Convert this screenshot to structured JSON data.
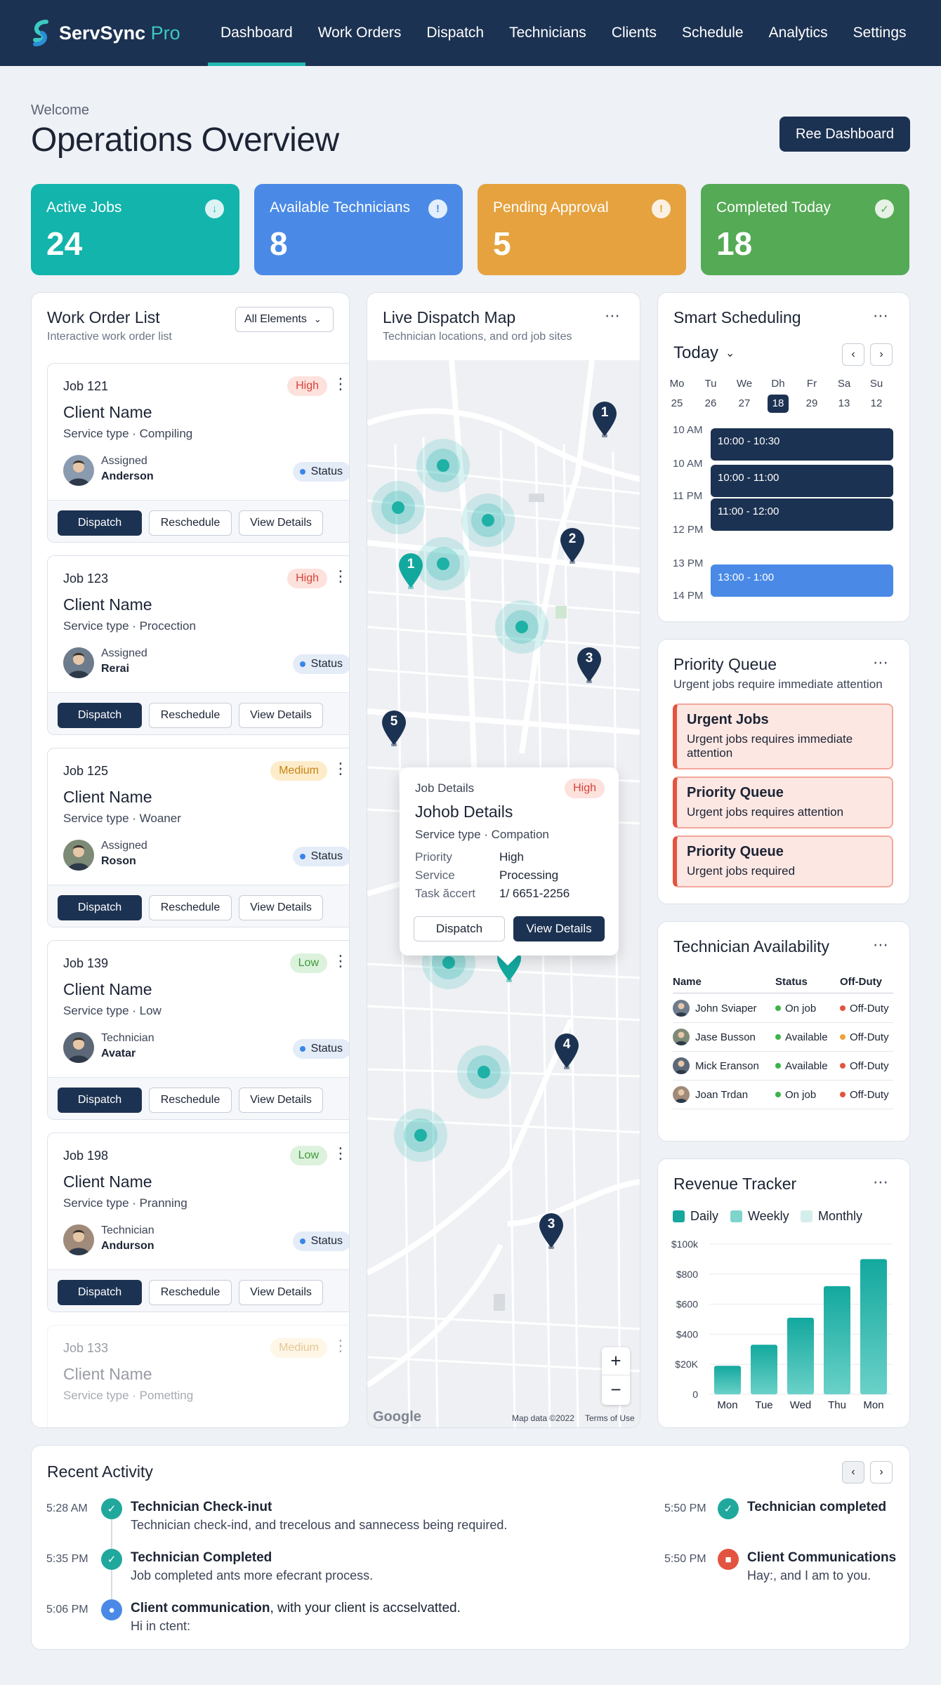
{
  "nav": {
    "brand": "ServSync",
    "brand_suffix": "Pro",
    "links": [
      "Dashboard",
      "Work Orders",
      "Dispatch",
      "Technicians",
      "Clients",
      "Schedule",
      "Analytics",
      "Settings"
    ],
    "active": "Dashboard"
  },
  "header": {
    "welcome": "Welcome",
    "title": "Operations Overview",
    "button": "Ree Dashboard"
  },
  "stats": [
    {
      "label": "Active Jobs",
      "value": "24",
      "color": "#13b4ac",
      "icon": "arrow-down-icon"
    },
    {
      "label": "Available Technicians",
      "value": "8",
      "color": "#4a8ae6",
      "icon": "info-icon"
    },
    {
      "label": "Pending Approval",
      "value": "5",
      "color": "#e5a23e",
      "icon": "alert-icon"
    },
    {
      "label": "Completed Today",
      "value": "18",
      "color": "#55aa55",
      "icon": "check-icon"
    }
  ],
  "work_orders": {
    "title": "Work Order List",
    "subtitle": "Interactive work order list",
    "filter": "All Elements",
    "jobs": [
      {
        "id": "Job 121",
        "priority": "High",
        "client": "Client Name",
        "service": "Service type · Compiling",
        "assignee_label": "Assigned",
        "assignee": "Anderson",
        "status": "Status"
      },
      {
        "id": "Job 123",
        "priority": "High",
        "client": "Client Name",
        "service": "Service type · Procection",
        "assignee_label": "Assigned",
        "assignee": "Rerai",
        "status": "Status"
      },
      {
        "id": "Job 125",
        "priority": "Medium",
        "client": "Client Name",
        "service": "Service type · Woaner",
        "assignee_label": "Assigned",
        "assignee": "Roson",
        "status": "Status"
      },
      {
        "id": "Job 139",
        "priority": "Low",
        "client": "Client Name",
        "service": "Service type · Low",
        "assignee_label": "Technician",
        "assignee": "Avatar",
        "status": "Status"
      },
      {
        "id": "Job 198",
        "priority": "Low",
        "client": "Client Name",
        "service": "Service type · Pranning",
        "assignee_label": "Technician",
        "assignee": "Andurson",
        "status": "Status"
      },
      {
        "id": "Job 133",
        "priority": "Medium",
        "client": "Client Name",
        "service": "Service type · Pometting"
      }
    ],
    "buttons": {
      "dispatch": "Dispatch",
      "reschedule": "Reschedule",
      "view": "View Details"
    }
  },
  "map": {
    "title": "Live Dispatch Map",
    "subtitle": "Technician locations, and ord job sites",
    "pins": [
      "1",
      "2",
      "1",
      "3",
      "5",
      "1",
      "4",
      "3"
    ],
    "popup": {
      "heading": "Job Details",
      "priority_badge": "High",
      "title": "Johob Details",
      "service": "Service type · Compation",
      "rows": [
        {
          "k": "Priority",
          "v": "High"
        },
        {
          "k": "Service",
          "v": "Processing"
        },
        {
          "k": "Task ăccert",
          "v": "1/ 6651-2256"
        }
      ],
      "dispatch": "Dispatch",
      "view": "View Details"
    },
    "zoom_in": "+",
    "zoom_out": "−",
    "google": "Google",
    "map_data": "Map data ©2022",
    "terms": "Terms of Use"
  },
  "scheduling": {
    "title": "Smart Scheduling",
    "today": "Today",
    "days": [
      "Mo",
      "Tu",
      "We",
      "Dh",
      "Fr",
      "Sa",
      "Su"
    ],
    "dates": [
      "25",
      "26",
      "27",
      "18",
      "29",
      "13",
      "12"
    ],
    "selected_date": "18",
    "times": [
      "10 AM",
      "10 AM",
      "11 PM",
      "12 PM",
      "13 PM",
      "14 PM"
    ],
    "events": [
      "10:00 - 10:30",
      "10:00 - 11:00",
      "11:00 - 12:00",
      "13:00 - 1:00"
    ]
  },
  "priority_queue": {
    "title": "Priority Queue",
    "subtitle": "Urgent jobs require immediate attention",
    "items": [
      {
        "title": "Urgent Jobs",
        "desc": "Urgent jobs requires immediate attention"
      },
      {
        "title": "Priority Queue",
        "desc": "Urgent jobs requires attention"
      },
      {
        "title": "Priority Queue",
        "desc": "Urgent jobs required"
      }
    ]
  },
  "availability": {
    "title": "Technician Availability",
    "headers": [
      "Name",
      "Status",
      "Off-Duty"
    ],
    "rows": [
      {
        "name": "John Sviaper",
        "status": "On job",
        "off": "Off-Duty",
        "off_color": "#e2543f"
      },
      {
        "name": "Jase Busson",
        "status": "Available",
        "off": "Off-Duty",
        "off_color": "#f0a23c"
      },
      {
        "name": "Mick Eranson",
        "status": "Available",
        "off": "Off-Duty",
        "off_color": "#e2543f"
      },
      {
        "name": "Joan Trdan",
        "status": "On job",
        "off": "Off-Duty",
        "off_color": "#e2543f"
      }
    ]
  },
  "revenue": {
    "title": "Revenue Tracker",
    "legend": [
      "Daily",
      "Weekly",
      "Monthly"
    ]
  },
  "chart_data": {
    "type": "bar",
    "title": "Revenue Tracker",
    "categories": [
      "Mon",
      "Tue",
      "Wed",
      "Thu",
      "Mon"
    ],
    "series": [
      {
        "name": "Daily",
        "values": [
          190,
          330,
          510,
          720,
          900
        ]
      }
    ],
    "ytick_labels": [
      "0",
      "$20K",
      "$400",
      "$600",
      "$800",
      "$100k"
    ],
    "ylim": [
      0,
      1000
    ],
    "legend": [
      "Daily",
      "Weekly",
      "Monthly"
    ],
    "legend_position": "top-left",
    "grid": true
  },
  "activity": {
    "title": "Recent Activity",
    "items": [
      {
        "time": "5:28 AM",
        "title": "Technician Check-inut",
        "desc": "Technician check-ind, and trecelous and sannecess being required."
      },
      {
        "time": "5:35 PM",
        "title": "Technician Completed",
        "desc": "Job completed ants more efecrant process."
      },
      {
        "time": "5:06 PM",
        "title": "Client communication",
        "title_rest": ", with your client is accselvatted.",
        "desc": "Hi in ctent:"
      }
    ],
    "right_items": [
      {
        "time": "5:50 PM",
        "title": "Technician completed"
      },
      {
        "time": "5:50 PM",
        "title": "Client Communications",
        "desc": "Hay:, and I am to you."
      }
    ]
  }
}
